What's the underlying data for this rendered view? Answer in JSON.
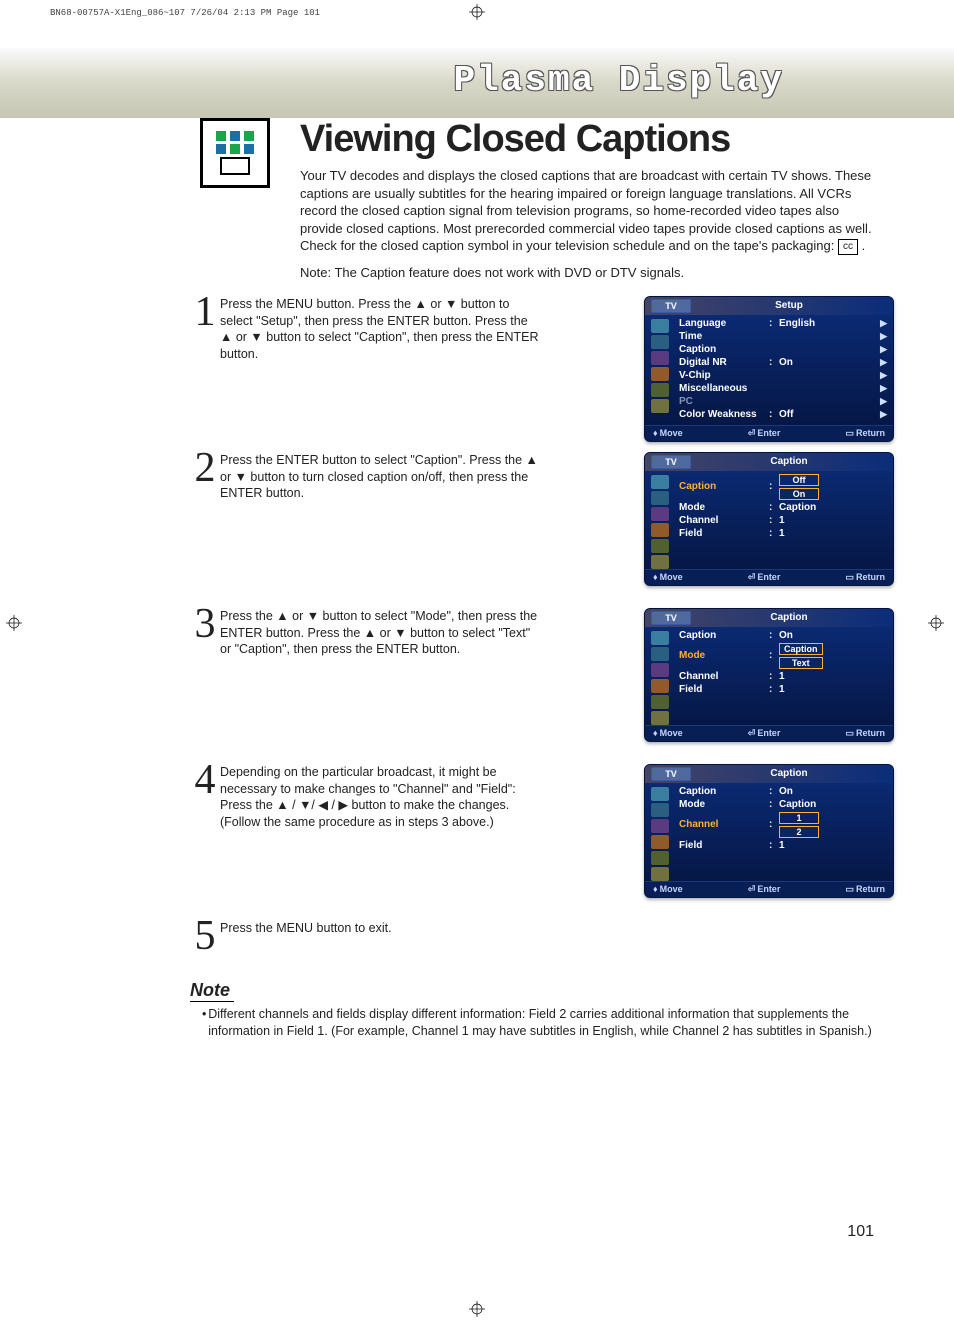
{
  "print_mark": "BN68-00757A-X1Eng_086~107  7/26/04  2:13 PM  Page 101",
  "header_graphic": "Plasma Display",
  "title": "Viewing Closed Captions",
  "intro": "Your TV decodes and displays the closed captions that are broadcast with certain TV shows. These captions are usually subtitles for the hearing impaired or foreign language translations. All VCRs record the closed caption signal from television programs, so home-recorded video tapes also provide closed captions. Most prerecorded commercial video tapes provide closed captions as well. Check for the closed caption symbol in your television schedule and on the tape's packaging:",
  "cc_symbol": "cc",
  "note_line": "Note: The Caption feature does not work with DVD or DTV signals.",
  "steps": {
    "s1": {
      "num": "1",
      "text": "Press the MENU button. Press the ▲ or ▼  button to select \"Setup\", then press the ENTER button. Press the ▲ or ▼ button to select \"Caption\", then press the ENTER button."
    },
    "s2": {
      "num": "2",
      "text": "Press the ENTER button to select \"Caption\". Press the ▲ or ▼ button to turn closed caption on/off, then press the ENTER button."
    },
    "s3": {
      "num": "3",
      "text": "Press the ▲ or ▼ button to select \"Mode\", then press the ENTER button. Press the ▲ or ▼ button to select \"Text\" or \"Caption\", then press the ENTER button."
    },
    "s4": {
      "num": "4",
      "text": "Depending on the particular broadcast, it might be necessary to make changes to \"Channel\" and \"Field\": Press the ▲ / ▼/ ◀ / ▶ button to make the changes. (Follow the same procedure as in steps 3 above.)"
    },
    "s5": {
      "num": "5",
      "text": "Press the MENU button to exit."
    }
  },
  "osd": {
    "tv_label": "TV",
    "footer": {
      "move": "Move",
      "enter": "Enter",
      "return": "Return"
    },
    "setup": {
      "title": "Setup",
      "rows": {
        "lang": {
          "label": "Language",
          "val": "English"
        },
        "time": {
          "label": "Time"
        },
        "cap": {
          "label": "Caption"
        },
        "dnr": {
          "label": "Digital NR",
          "val": "On"
        },
        "vchip": {
          "label": "V-Chip"
        },
        "misc": {
          "label": "Miscellaneous"
        },
        "pc": {
          "label": "PC"
        },
        "cw": {
          "label": "Color Weakness",
          "val": "Off"
        }
      }
    },
    "caption2": {
      "title": "Caption",
      "rows": {
        "cap": {
          "label": "Caption",
          "opt1": "Off",
          "opt2": "On"
        },
        "mode": {
          "label": "Mode",
          "val": "Caption"
        },
        "chan": {
          "label": "Channel",
          "val": "1"
        },
        "field": {
          "label": "Field",
          "val": "1"
        }
      }
    },
    "caption3": {
      "title": "Caption",
      "rows": {
        "cap": {
          "label": "Caption",
          "val": "On"
        },
        "mode": {
          "label": "Mode",
          "opt1": "Caption",
          "opt2": "Text"
        },
        "chan": {
          "label": "Channel",
          "val": "1"
        },
        "field": {
          "label": "Field",
          "val": "1"
        }
      }
    },
    "caption4": {
      "title": "Caption",
      "rows": {
        "cap": {
          "label": "Caption",
          "val": "On"
        },
        "mode": {
          "label": "Mode",
          "val": "Caption"
        },
        "chan": {
          "label": "Channel",
          "opt1": "1",
          "opt2": "2"
        },
        "field": {
          "label": "Field",
          "val": "1"
        }
      }
    }
  },
  "note_section": {
    "heading": "Note",
    "body": "Different channels and fields display different information: Field 2 carries additional information that supplements the information in Field 1. (For example, Channel 1 may have subtitles in English, while Channel 2 has subtitles in Spanish.)"
  },
  "page_num": "101"
}
